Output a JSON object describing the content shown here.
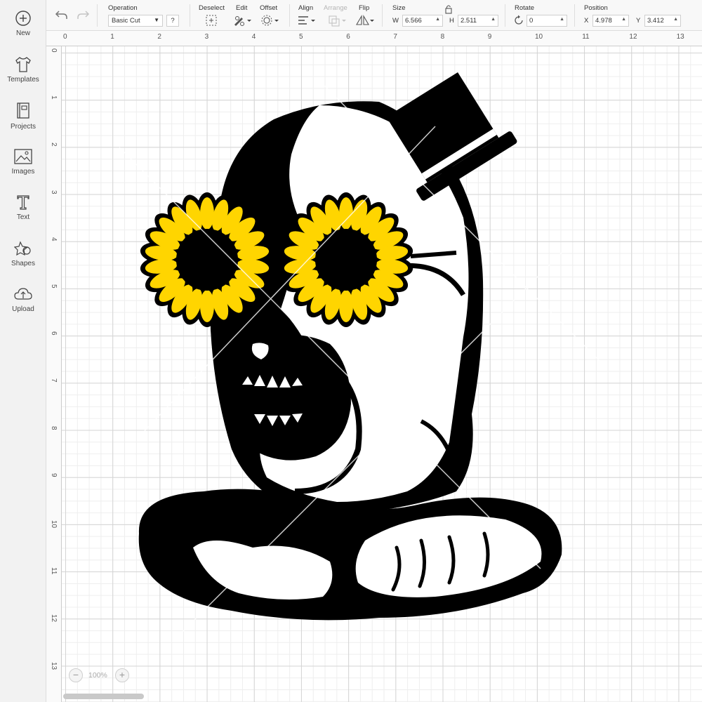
{
  "sidebar": {
    "items": [
      {
        "label": "New",
        "icon": "plus-circle-icon"
      },
      {
        "label": "Templates",
        "icon": "tshirt-icon"
      },
      {
        "label": "Projects",
        "icon": "projects-book-icon"
      },
      {
        "label": "Images",
        "icon": "image-icon"
      },
      {
        "label": "Text",
        "icon": "text-t-icon"
      },
      {
        "label": "Shapes",
        "icon": "shapes-icon"
      },
      {
        "label": "Upload",
        "icon": "cloud-upload-icon"
      }
    ]
  },
  "toolbar": {
    "undo_icon": "undo-icon",
    "redo_icon": "redo-icon",
    "operation": {
      "label": "Operation",
      "value": "Basic Cut",
      "help": "?"
    },
    "deselect_label": "Deselect",
    "edit_label": "Edit",
    "offset_label": "Offset",
    "align_label": "Align",
    "arrange_label": "Arrange",
    "flip_label": "Flip",
    "size": {
      "label": "Size",
      "w_letter": "W",
      "w_value": "6.566",
      "h_letter": "H",
      "h_value": "2.511",
      "lock_icon": "lock-icon"
    },
    "rotate": {
      "label": "Rotate",
      "value": "0"
    },
    "position": {
      "label": "Position",
      "x_letter": "X",
      "x_value": "4.978",
      "y_letter": "Y",
      "y_value": "3.412"
    }
  },
  "rulers": {
    "top": [
      "0",
      "1",
      "2",
      "3",
      "4",
      "5",
      "6",
      "7",
      "8",
      "9",
      "10",
      "11",
      "12",
      "13"
    ],
    "left": [
      "0",
      "1",
      "2",
      "3",
      "4",
      "5",
      "6",
      "7",
      "8",
      "9",
      "10",
      "11",
      "12",
      "13"
    ]
  },
  "zoom": {
    "minus": "−",
    "value": "100%",
    "plus": "+"
  },
  "design": {
    "name": "clown-with-sunflower-glasses",
    "colors": {
      "ink": "#000000",
      "petal": "#FFD500",
      "paper": "#FFFFFF",
      "watermark": "#FFFFFF"
    }
  }
}
